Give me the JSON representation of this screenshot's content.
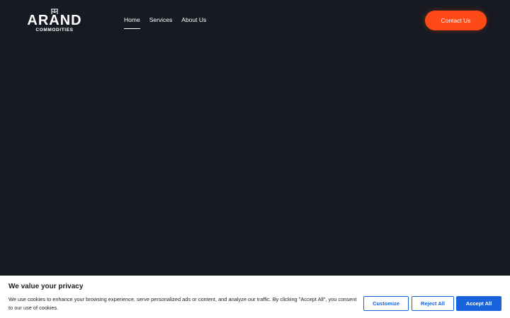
{
  "header": {
    "logo": {
      "word": "ARAND",
      "sub": "COMMODITIES"
    },
    "nav": [
      {
        "label": "Home",
        "active": true
      },
      {
        "label": "Services",
        "active": false
      },
      {
        "label": "About Us",
        "active": false
      }
    ],
    "contact_label": "Contact Us"
  },
  "cookie_banner": {
    "title": "We value your privacy",
    "text": "We use cookies to enhance your browsing experience, serve personalized ads or content, and analyze our traffic. By clicking \"Accept All\", you consent to our use of cookies.",
    "customize_label": "Customize",
    "reject_label": "Reject All",
    "accept_label": "Accept All"
  },
  "colors": {
    "background": "#171a22",
    "accent": "#ff4a17",
    "consent_blue": "#1863dc"
  }
}
